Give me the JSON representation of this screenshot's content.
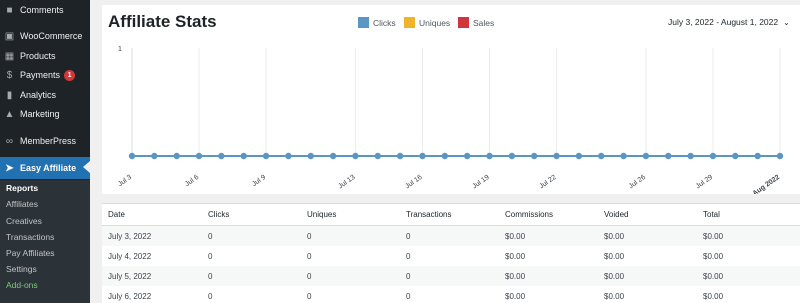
{
  "sidebar": {
    "items": [
      {
        "label": "Comments",
        "icon": "comments-icon"
      },
      {
        "label": "WooCommerce",
        "icon": "woocommerce-icon"
      },
      {
        "label": "Products",
        "icon": "products-icon"
      },
      {
        "label": "Payments",
        "icon": "payments-icon",
        "badge": "1"
      },
      {
        "label": "Analytics",
        "icon": "analytics-icon"
      },
      {
        "label": "Marketing",
        "icon": "marketing-icon"
      },
      {
        "label": "MemberPress",
        "icon": "memberpress-icon"
      },
      {
        "label": "Easy Affiliate",
        "icon": "easy-affiliate-icon",
        "active": true
      }
    ],
    "submenu": [
      "Reports",
      "Affiliates",
      "Creatives",
      "Transactions",
      "Pay Affiliates",
      "Settings",
      "Add-ons"
    ]
  },
  "header": {
    "title": "Affiliate Stats",
    "date_range": "July 3, 2022 - August 1, 2022"
  },
  "colors": {
    "clicks": "#5a96c3",
    "uniques": "#f0b429",
    "sales": "#d0343c",
    "sidebar_bg": "#1d2327",
    "active": "#2271b1"
  },
  "chart_data": {
    "type": "line",
    "legend": [
      "Clicks",
      "Uniques",
      "Sales"
    ],
    "x_tick_labels": [
      "Jul 3",
      "Jul 6",
      "Jul 9",
      "Jul 13",
      "Jul 16",
      "Jul 19",
      "Jul 22",
      "Jul 26",
      "Jul 29",
      "Aug 2022"
    ],
    "x": [
      "Jul 3",
      "Jul 4",
      "Jul 5",
      "Jul 6",
      "Jul 7",
      "Jul 8",
      "Jul 9",
      "Jul 10",
      "Jul 11",
      "Jul 12",
      "Jul 13",
      "Jul 14",
      "Jul 15",
      "Jul 16",
      "Jul 17",
      "Jul 18",
      "Jul 19",
      "Jul 20",
      "Jul 21",
      "Jul 22",
      "Jul 23",
      "Jul 24",
      "Jul 25",
      "Jul 26",
      "Jul 27",
      "Jul 28",
      "Jul 29",
      "Jul 30",
      "Jul 31",
      "Aug 1"
    ],
    "series": [
      {
        "name": "Clicks",
        "values": [
          0,
          0,
          0,
          0,
          0,
          0,
          0,
          0,
          0,
          0,
          0,
          0,
          0,
          0,
          0,
          0,
          0,
          0,
          0,
          0,
          0,
          0,
          0,
          0,
          0,
          0,
          0,
          0,
          0,
          0
        ]
      }
    ],
    "y_tick_labels": [
      "1"
    ],
    "ylim": [
      0,
      1
    ],
    "grid": true
  },
  "table": {
    "columns": [
      "Date",
      "Clicks",
      "Uniques",
      "Transactions",
      "Commissions",
      "Voided",
      "Total"
    ],
    "rows": [
      [
        "July 3, 2022",
        "0",
        "0",
        "0",
        "$0.00",
        "$0.00",
        "$0.00"
      ],
      [
        "July 4, 2022",
        "0",
        "0",
        "0",
        "$0.00",
        "$0.00",
        "$0.00"
      ],
      [
        "July 5, 2022",
        "0",
        "0",
        "0",
        "$0.00",
        "$0.00",
        "$0.00"
      ],
      [
        "July 6, 2022",
        "0",
        "0",
        "0",
        "$0.00",
        "$0.00",
        "$0.00"
      ]
    ]
  }
}
